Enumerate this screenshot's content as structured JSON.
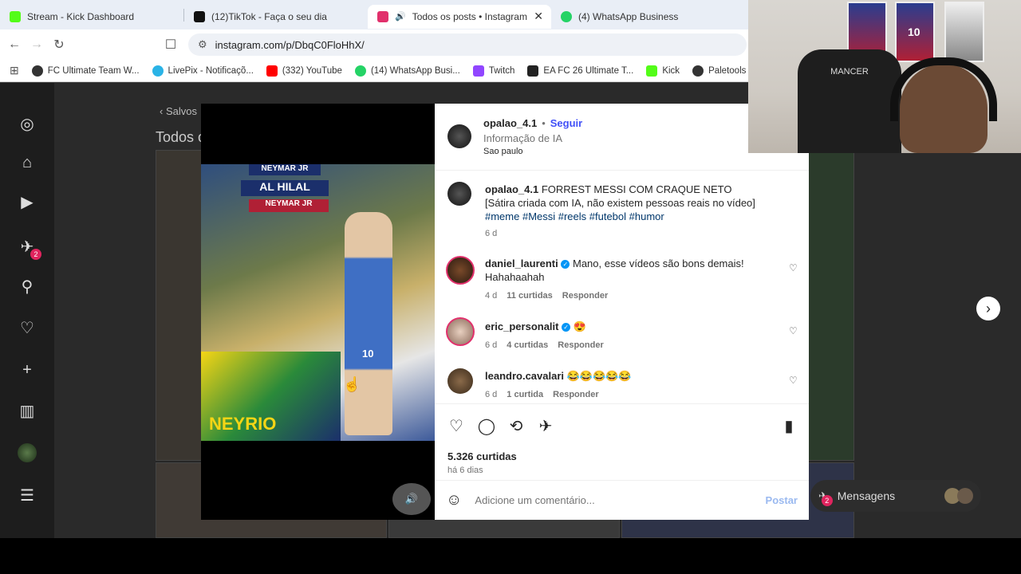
{
  "browser": {
    "tabs": [
      {
        "title": "Stream - Kick Dashboard",
        "color": "#53fc18"
      },
      {
        "title": "(12)TikTok - Faça o seu dia",
        "color": "#111111"
      },
      {
        "title": "Todos os posts • Instagram",
        "color": "#e1306c"
      },
      {
        "title": "(4) WhatsApp Business",
        "color": "#25d366"
      }
    ],
    "url": "instagram.com/p/DbqC0FloHhX/",
    "bookmarks": [
      {
        "label": "FC Ultimate Team W...",
        "color": "#333333"
      },
      {
        "label": "LivePix - Notificaçõ...",
        "color": "#2ab3e6"
      },
      {
        "label": "(332) YouTube",
        "color": "#ff0000"
      },
      {
        "label": "(14) WhatsApp Busi...",
        "color": "#25d366"
      },
      {
        "label": "Twitch",
        "color": "#9146ff"
      },
      {
        "label": "EA FC 26 Ultimate T...",
        "color": "#222222"
      },
      {
        "label": "Kick",
        "color": "#53fc18"
      },
      {
        "label": "Paletools v2",
        "color": "#333333"
      }
    ]
  },
  "background": {
    "back_label": "Salvos",
    "title": "Todos os posts",
    "messages_label": "Mensagens",
    "messages_badge": "2",
    "notif_badge": "2"
  },
  "photo": {
    "banner1": "NEYMAR JR",
    "banner2": "AL HILAL",
    "banner3": "NEYMAR JR",
    "bed_text": "NEYRIO",
    "jersey_number": "10"
  },
  "post": {
    "username": "opalao_4.1",
    "separator": "•",
    "follow": "Seguir",
    "ai_info": "Informação de IA",
    "location": "Sao paulo",
    "caption_user": "opalao_4.1",
    "caption_text": "FORREST MESSI COM CRAQUE NETO",
    "caption_line2": "[Sátira criada com IA, não existem pessoas reais no vídeo]",
    "hashtags": "#meme #Messi #reels #futebol #humor",
    "caption_age": "6 d",
    "likes": "5.326 curtidas",
    "posted_ago": "há 6 dias",
    "comment_placeholder": "Adicione um comentário...",
    "post_button": "Postar"
  },
  "comments": [
    {
      "user": "daniel_laurenti",
      "verified": true,
      "text": "Mano, esse vídeos são bons demais! Hahahaahah",
      "age": "4 d",
      "likes": "11 curtidas",
      "reply": "Responder"
    },
    {
      "user": "eric_personalit",
      "verified": true,
      "text": "😍",
      "age": "6 d",
      "likes": "4 curtidas",
      "reply": "Responder"
    },
    {
      "user": "leandro.cavalari",
      "verified": false,
      "text": "😂😂😂😂😂",
      "age": "6 d",
      "likes": "1 curtida",
      "reply": "Responder"
    }
  ],
  "webcam": {
    "chair_brand": "MANCER",
    "poster_number": "10"
  }
}
